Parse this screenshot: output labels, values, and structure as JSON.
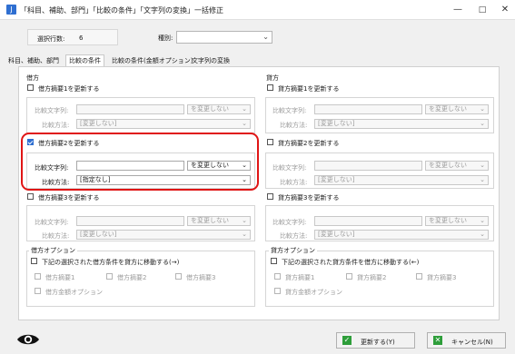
{
  "window": {
    "title": "「科目、補助、部門」「比較の条件」「文字列の変換」一括修正",
    "icon_name": "app-icon",
    "minimize_glyph": "—",
    "maximize_glyph": "□",
    "close_glyph": "✕"
  },
  "header": {
    "count_label": "選択行数:",
    "count_value": "6",
    "type_label": "種別:",
    "type_value": ""
  },
  "tabs": [
    {
      "label": "科目、補助、部門",
      "active": false
    },
    {
      "label": "比較の条件",
      "active": true
    },
    {
      "label": "比較の条件(金額オプション)",
      "active": false
    },
    {
      "label": "文字列の変換",
      "active": false
    }
  ],
  "debit": {
    "title": "借方",
    "summaries": [
      {
        "checkbox_label": "借方摘要1を更新する",
        "checked": false,
        "compare_text_label": "比較文字列:",
        "compare_text_value": "",
        "mode_value": "を変更しない",
        "method_label": "比較方法:",
        "method_value": "[変更しない]"
      },
      {
        "checkbox_label": "借方摘要2を更新する",
        "checked": true,
        "compare_text_label": "比較文字列:",
        "compare_text_value": "",
        "mode_value": "を変更しない",
        "method_label": "比較方法:",
        "method_value": "[指定なし]"
      },
      {
        "checkbox_label": "借方摘要3を更新する",
        "checked": false,
        "compare_text_label": "比較文字列:",
        "compare_text_value": "",
        "mode_value": "を変更しない",
        "method_label": "比較方法:",
        "method_value": "[変更しない]"
      }
    ],
    "option_title": "借方オプション",
    "option_move_label": "下記の選択された借方条件を貸方に移動する(→)",
    "option_items": [
      "借方摘要1",
      "借方摘要2",
      "借方摘要3",
      "借方金額オプション"
    ]
  },
  "credit": {
    "title": "貸方",
    "summaries": [
      {
        "checkbox_label": "貸方摘要1を更新する",
        "checked": false,
        "compare_text_label": "比較文字列:",
        "compare_text_value": "",
        "mode_value": "を変更しない",
        "method_label": "比較方法:",
        "method_value": "[変更しない]"
      },
      {
        "checkbox_label": "貸方摘要2を更新する",
        "checked": false,
        "compare_text_label": "比較文字列:",
        "compare_text_value": "",
        "mode_value": "を変更しない",
        "method_label": "比較方法:",
        "method_value": "[変更しない]"
      },
      {
        "checkbox_label": "貸方摘要3を更新する",
        "checked": false,
        "compare_text_label": "比較文字列:",
        "compare_text_value": "",
        "mode_value": "を変更しない",
        "method_label": "比較方法:",
        "method_value": "[変更しない]"
      }
    ],
    "option_title": "貸方オプション",
    "option_move_label": "下記の選択された貸方条件を借方に移動する(←)",
    "option_items": [
      "貸方摘要1",
      "貸方摘要2",
      "貸方摘要3",
      "貸方金額オプション"
    ]
  },
  "footer": {
    "eye_icon": "eye-icon",
    "update_label": "更新する(Y)",
    "update_icon": "check-icon",
    "update_icon_color": "#2e9e3a",
    "cancel_label": "キャンセル(N)",
    "cancel_icon": "close-icon",
    "cancel_icon_color": "#2e9e3a"
  },
  "colors": {
    "highlight": "#e01515",
    "checkbox_checked": "#2f6fd1"
  }
}
